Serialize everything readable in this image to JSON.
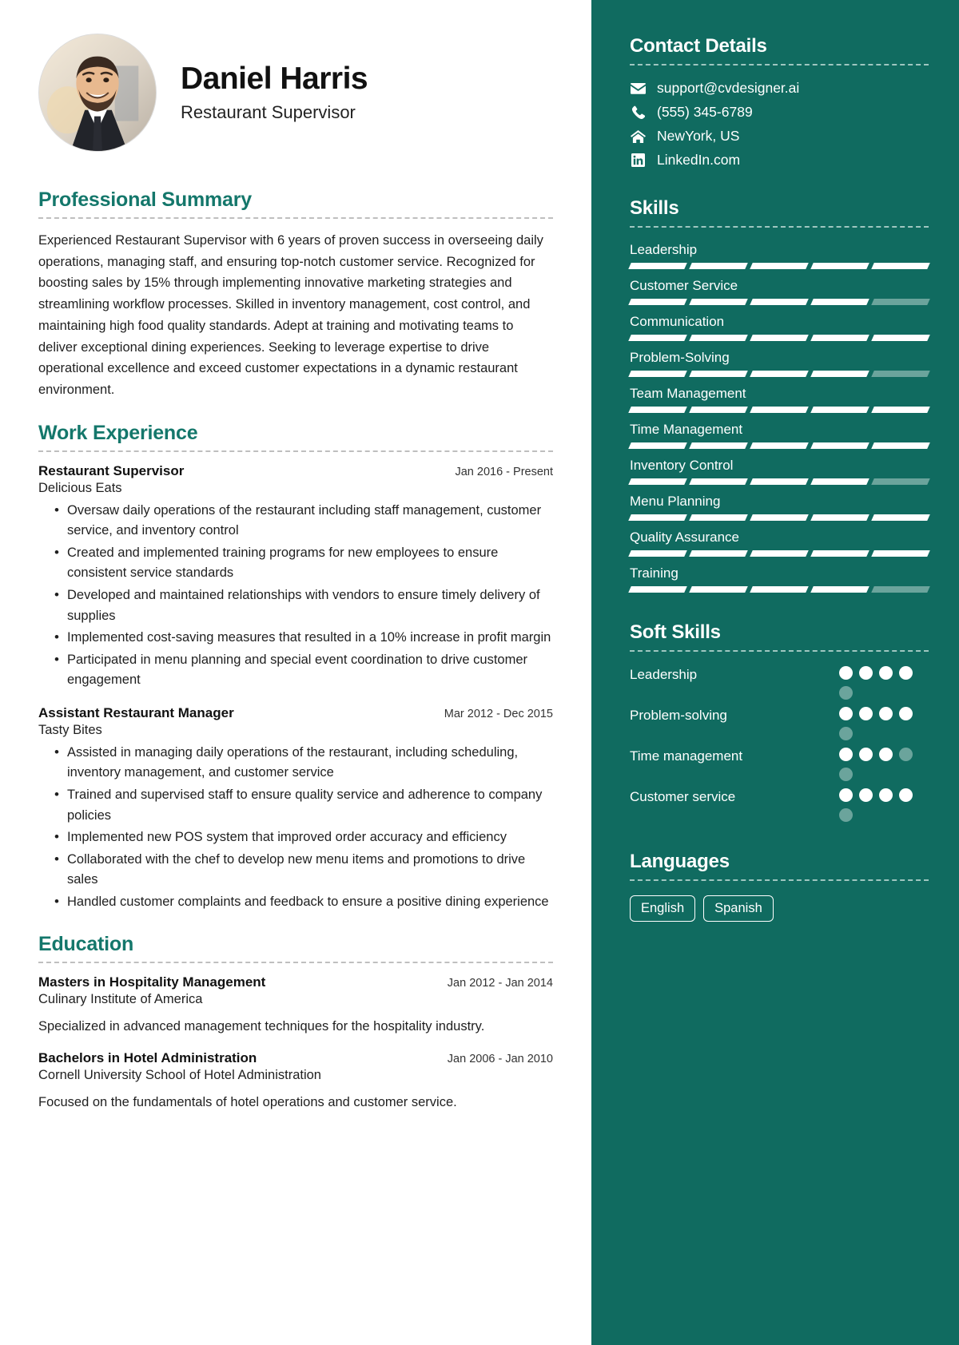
{
  "profile": {
    "name": "Daniel Harris",
    "role": "Restaurant Supervisor"
  },
  "summary": {
    "heading": "Professional Summary",
    "text": "Experienced Restaurant Supervisor with 6 years of proven success in overseeing daily operations, managing staff, and ensuring top-notch customer service. Recognized for boosting sales by 15% through implementing innovative marketing strategies and streamlining workflow processes. Skilled in inventory management, cost control, and maintaining high food quality standards. Adept at training and motivating teams to deliver exceptional dining experiences. Seeking to leverage expertise to drive operational excellence and exceed customer expectations in a dynamic restaurant environment."
  },
  "work": {
    "heading": "Work Experience",
    "jobs": [
      {
        "title": "Restaurant Supervisor",
        "date": "Jan 2016 - Present",
        "org": "Delicious Eats",
        "bullets": [
          "Oversaw daily operations of the restaurant including staff management, customer service, and inventory control",
          "Created and implemented training programs for new employees to ensure consistent service standards",
          "Developed and maintained relationships with vendors to ensure timely delivery of supplies",
          "Implemented cost-saving measures that resulted in a 10% increase in profit margin",
          "Participated in menu planning and special event coordination to drive customer engagement"
        ]
      },
      {
        "title": "Assistant Restaurant Manager",
        "date": "Mar 2012 - Dec 2015",
        "org": "Tasty Bites",
        "bullets": [
          "Assisted in managing daily operations of the restaurant, including scheduling, inventory management, and customer service",
          "Trained and supervised staff to ensure quality service and adherence to company policies",
          "Implemented new POS system that improved order accuracy and efficiency",
          "Collaborated with the chef to develop new menu items and promotions to drive sales",
          "Handled customer complaints and feedback to ensure a positive dining experience"
        ]
      }
    ]
  },
  "education": {
    "heading": "Education",
    "items": [
      {
        "degree": "Masters in Hospitality Management",
        "date": "Jan 2012 - Jan 2014",
        "school": "Culinary Institute of America",
        "desc": "Specialized in advanced management techniques for the hospitality industry."
      },
      {
        "degree": "Bachelors in Hotel Administration",
        "date": "Jan 2006 - Jan 2010",
        "school": "Cornell University School of Hotel Administration",
        "desc": "Focused on the fundamentals of hotel operations and customer service."
      }
    ]
  },
  "contact": {
    "heading": "Contact Details",
    "items": [
      {
        "icon": "envelope-icon",
        "value": "support@cvdesigner.ai"
      },
      {
        "icon": "phone-icon",
        "value": "(555) 345-6789"
      },
      {
        "icon": "home-icon",
        "value": "NewYork, US"
      },
      {
        "icon": "linkedin-icon",
        "value": "LinkedIn.com"
      }
    ]
  },
  "skills": {
    "heading": "Skills",
    "segments": 5,
    "items": [
      {
        "name": "Leadership",
        "level": 5
      },
      {
        "name": "Customer Service",
        "level": 4
      },
      {
        "name": "Communication",
        "level": 5
      },
      {
        "name": "Problem-Solving",
        "level": 4
      },
      {
        "name": "Team Management",
        "level": 5
      },
      {
        "name": "Time Management",
        "level": 5
      },
      {
        "name": "Inventory Control",
        "level": 4
      },
      {
        "name": "Menu Planning",
        "level": 5
      },
      {
        "name": "Quality Assurance",
        "level": 5
      },
      {
        "name": "Training",
        "level": 4
      }
    ]
  },
  "soft_skills": {
    "heading": "Soft Skills",
    "dots": 5,
    "items": [
      {
        "name": "Leadership",
        "level": 4
      },
      {
        "name": "Problem-solving",
        "level": 4
      },
      {
        "name": "Time management",
        "level": 3
      },
      {
        "name": "Customer service",
        "level": 4
      }
    ]
  },
  "languages": {
    "heading": "Languages",
    "items": [
      "English",
      "Spanish"
    ]
  },
  "colors": {
    "accent": "#14776b",
    "sidebar": "#106b60",
    "muted_segment": "#6ba49c"
  }
}
